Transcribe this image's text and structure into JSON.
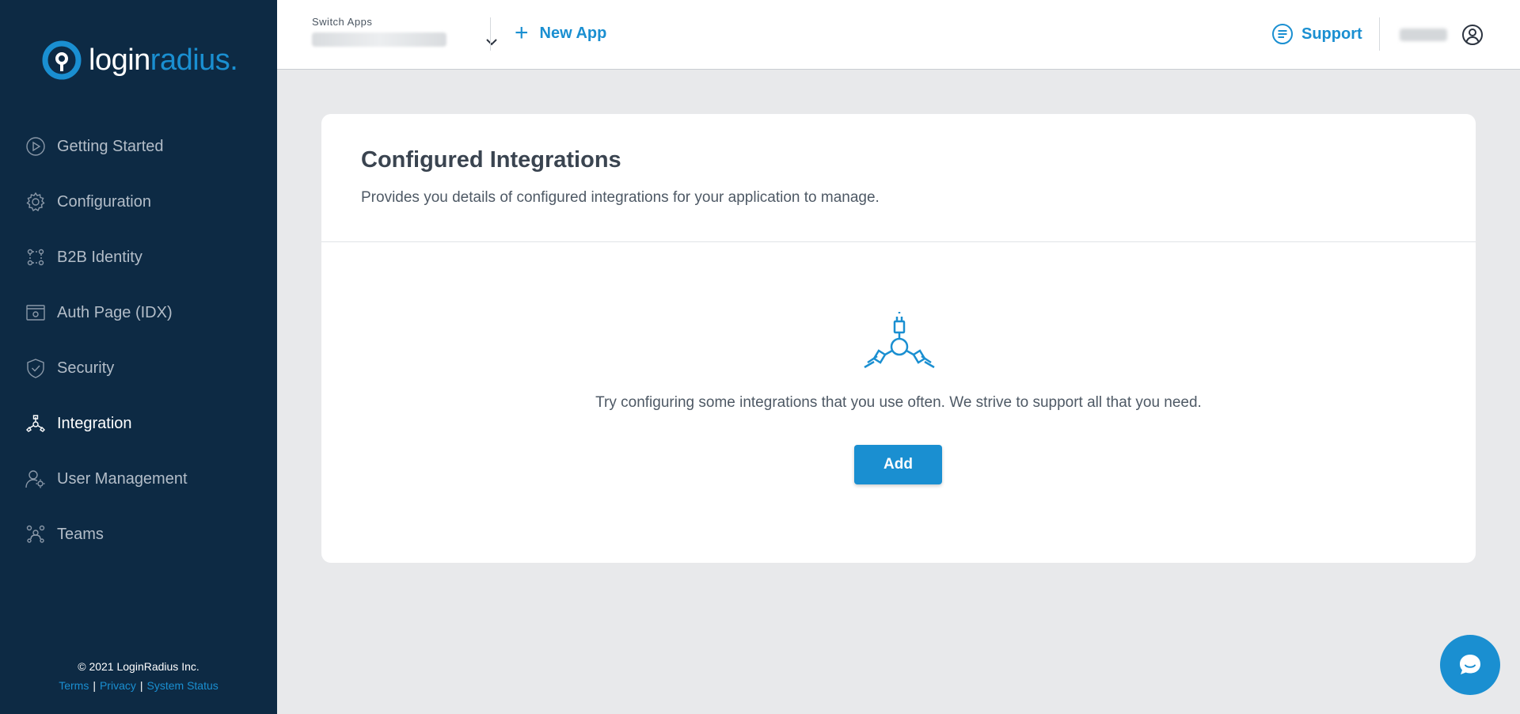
{
  "brand": {
    "name_part1": "login",
    "name_part2": "radius",
    "name_dot": "."
  },
  "sidebar": {
    "items": [
      {
        "label": "Getting Started",
        "icon": "play-circle-icon",
        "active": false
      },
      {
        "label": "Configuration",
        "icon": "gear-icon",
        "active": false
      },
      {
        "label": "B2B Identity",
        "icon": "b2b-network-icon",
        "active": false
      },
      {
        "label": "Auth Page (IDX)",
        "icon": "browser-window-icon",
        "active": false
      },
      {
        "label": "Security",
        "icon": "shield-icon",
        "active": false
      },
      {
        "label": "Integration",
        "icon": "integration-icon",
        "active": true
      },
      {
        "label": "User Management",
        "icon": "user-gear-icon",
        "active": false
      },
      {
        "label": "Teams",
        "icon": "team-icon",
        "active": false
      }
    ],
    "footer": {
      "copyright": "© 2021 LoginRadius Inc.",
      "links": [
        "Terms",
        "Privacy",
        "System Status"
      ]
    }
  },
  "topbar": {
    "switch_apps_label": "Switch Apps",
    "new_app_label": "New App",
    "support_label": "Support"
  },
  "main": {
    "title": "Configured Integrations",
    "description": "Provides you details of configured integrations for your application to manage.",
    "empty_message": "Try configuring some integrations that you use often. We strive to support all that you need.",
    "add_button_label": "Add"
  },
  "colors": {
    "sidebar_bg": "#0d2a44",
    "accent": "#1a8fd1",
    "page_bg": "#e8e9eb"
  }
}
